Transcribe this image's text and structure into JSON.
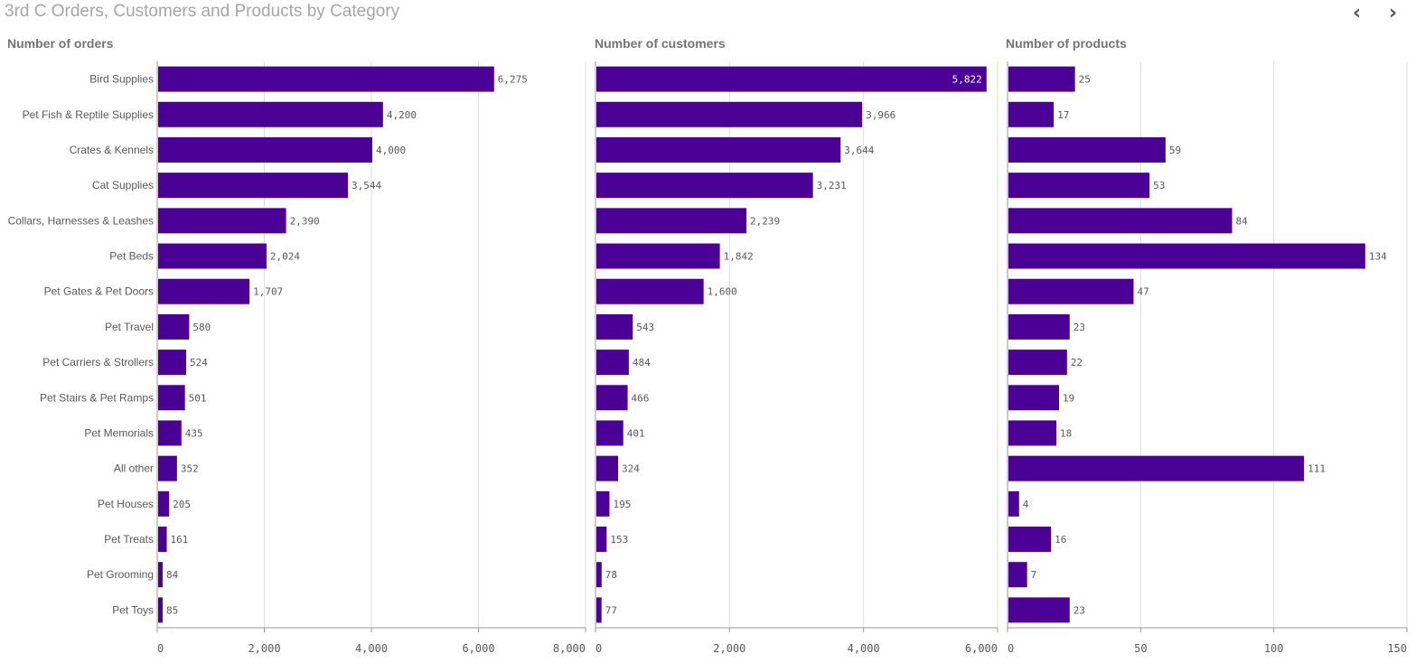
{
  "title": "3rd C Orders, Customers and Products by Category",
  "nav": {
    "prev_icon": "chevron-left-icon",
    "next_icon": "chevron-right-icon",
    "prev": "‹",
    "next": "›"
  },
  "colors": {
    "bar": "#4b0096",
    "grid": "#e0e0e0",
    "axis": "#999999",
    "text": "#595959"
  },
  "chart_data": [
    {
      "type": "bar",
      "orientation": "horizontal",
      "title": "Number of orders",
      "categories": [
        "Bird Supplies",
        "Pet Fish & Reptile Supplies",
        "Crates & Kennels",
        "Cat Supplies",
        "Collars, Harnesses & Leashes",
        "Pet Beds",
        "Pet Gates & Pet Doors",
        "Pet Travel",
        "Pet Carriers & Strollers",
        "Pet Stairs & Pet Ramps",
        "Pet Memorials",
        "All other",
        "Pet Houses",
        "Pet Treats",
        "Pet Grooming",
        "Pet Toys"
      ],
      "values": [
        6275,
        4200,
        4000,
        3544,
        2390,
        2024,
        1707,
        580,
        524,
        501,
        435,
        352,
        205,
        161,
        84,
        85
      ],
      "xlim": [
        0,
        8000
      ],
      "ticks": [
        "0",
        "2,000",
        "4,000",
        "6,000",
        "8,000"
      ],
      "grid": true
    },
    {
      "type": "bar",
      "orientation": "horizontal",
      "title": "Number of customers",
      "values": [
        5822,
        3966,
        3644,
        3231,
        2239,
        1842,
        1600,
        543,
        484,
        466,
        401,
        324,
        195,
        153,
        78,
        77
      ],
      "xlim": [
        0,
        6000
      ],
      "ticks": [
        "0",
        "2,000",
        "4,000",
        "6,000"
      ],
      "grid": true
    },
    {
      "type": "bar",
      "orientation": "horizontal",
      "title": "Number of products",
      "values": [
        25,
        17,
        59,
        53,
        84,
        134,
        47,
        23,
        22,
        19,
        18,
        111,
        4,
        16,
        7,
        23
      ],
      "xlim": [
        0,
        150
      ],
      "ticks": [
        "0",
        "50",
        "100",
        "150"
      ],
      "grid": true
    }
  ]
}
